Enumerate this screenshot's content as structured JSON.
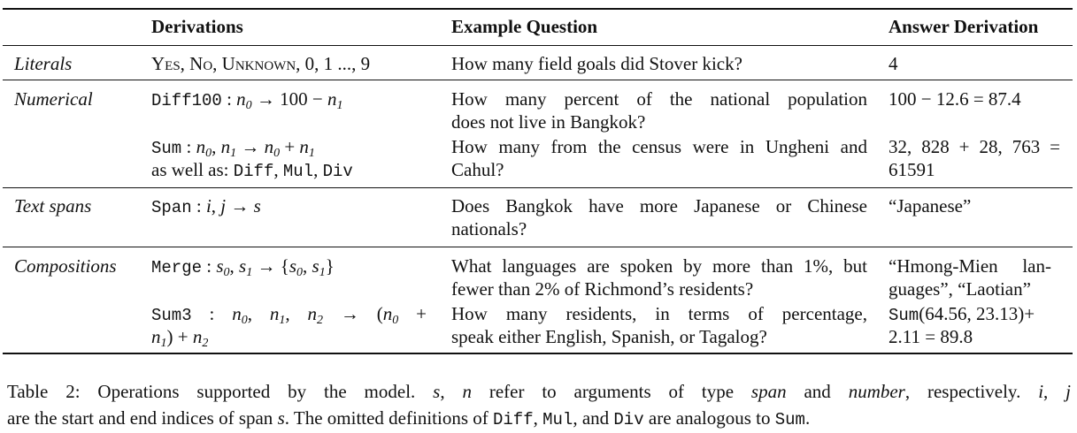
{
  "table": {
    "headers": [
      "Derivations",
      "Example Question",
      "Answer Derivation"
    ],
    "rows": [
      {
        "category": "Literals",
        "derivation_lines": [
          "Yes, No, Unknown, 0, 1 ..., 9"
        ],
        "question_lines": [
          "How many field goals did Stover kick?"
        ],
        "answer_lines": [
          "4"
        ]
      },
      {
        "category": "Numerical",
        "items": [
          {
            "derivation_op": "Diff100",
            "derivation_expr": "n0 → 100 − n1",
            "question_lines": [
              "How many percent of the national population",
              "does not live in Bangkok?"
            ],
            "answer_lines": [
              "100 − 12.6 = 87.4"
            ]
          },
          {
            "derivation_op": "Sum",
            "derivation_expr": "n0, n1 → n0 + n1",
            "derivation_extra_prefix": "as well as: ",
            "derivation_extra_ops": [
              "Diff",
              "Mul",
              "Div"
            ],
            "question_lines": [
              "How many from the census were in Ungheni and",
              "Cahul?"
            ],
            "answer_lines": [
              "32, 828 + 28, 763 =",
              "61591"
            ]
          }
        ]
      },
      {
        "category": "Text spans",
        "derivation_op": "Span",
        "derivation_expr": "i, j → s",
        "question_lines": [
          "Does Bangkok have more Japanese or Chinese",
          "nationals?"
        ],
        "answer_lines": [
          "“Japanese”"
        ]
      },
      {
        "category": "Compositions",
        "items": [
          {
            "derivation_op": "Merge",
            "derivation_expr": "s0, s1 → {s0, s1}",
            "question_lines": [
              "What languages are spoken by more than 1%, but",
              "fewer than 2% of Richmond’s residents?"
            ],
            "answer_lines": [
              "“Hmong-Mien lan-",
              "guages”, “Laotian”"
            ]
          },
          {
            "derivation_op": "Sum3",
            "derivation_expr": "n0, n1, n2 → (n0 + n1) + n2",
            "question_lines": [
              "How many residents, in terms of percentage,",
              "speak either English, Spanish, or Tagalog?"
            ],
            "answer_op": "Sum",
            "answer_lines": [
              "(64.56, 23.13)+",
              "2.11 = 89.8"
            ]
          }
        ]
      }
    ]
  },
  "caption": {
    "label": "Table 2:",
    "line1": "Operations supported by the model. s, n refer to arguments of type span and number, respectively. i, j",
    "line2": "are the start and end indices of span s. The omitted definitions of Diff, Mul, and Div are analogous to Sum."
  }
}
